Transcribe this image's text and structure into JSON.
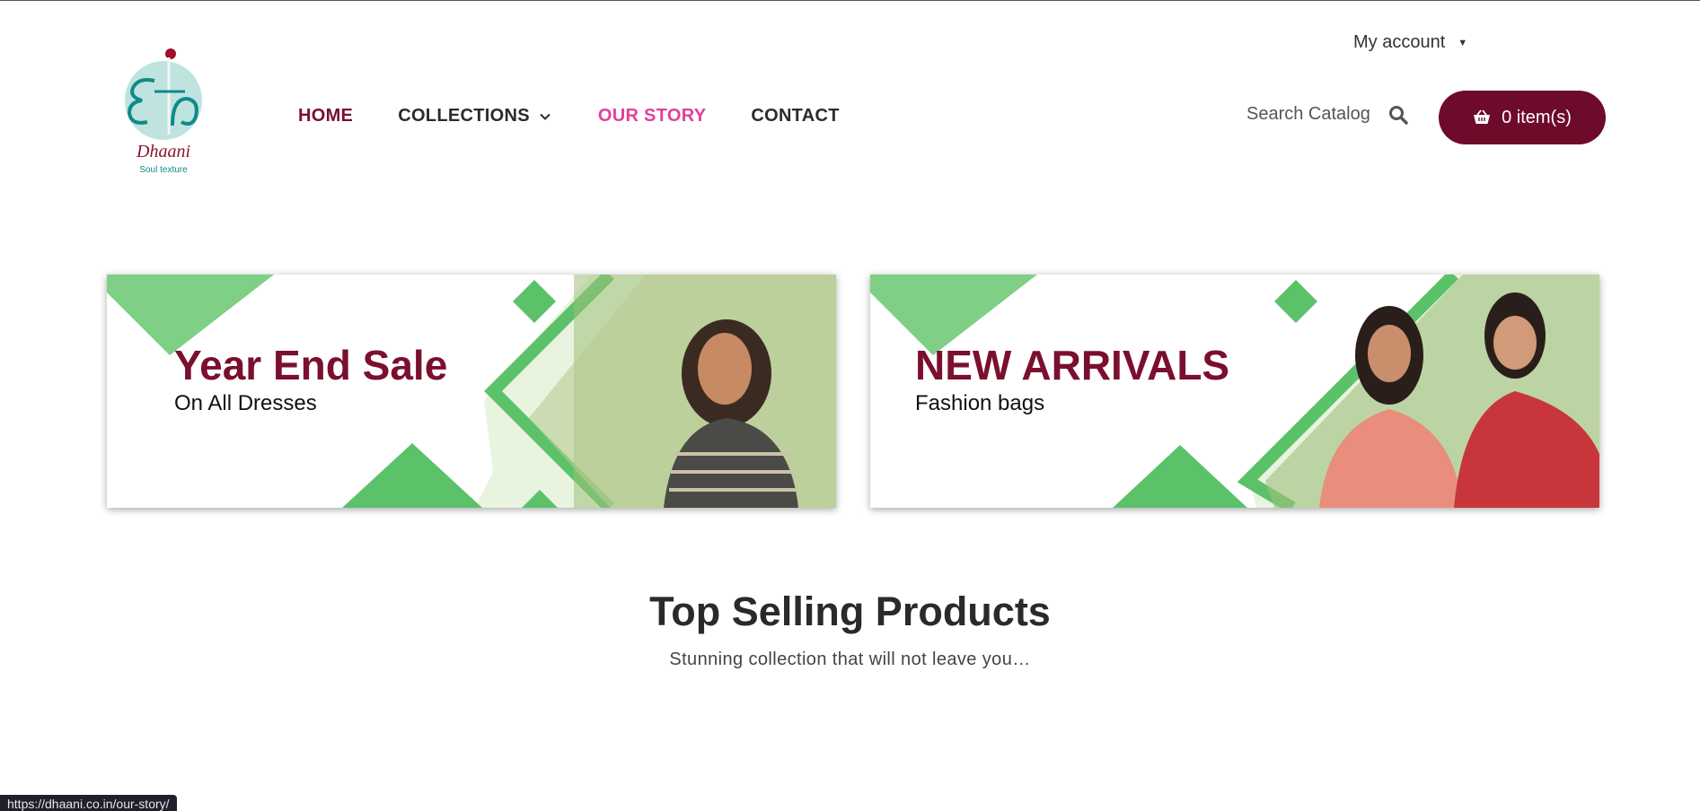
{
  "header": {
    "account_label": "My account",
    "logo_text": "Dhaani",
    "logo_tagline": "Soul texture"
  },
  "nav": {
    "home": "HOME",
    "collections": "COLLECTIONS",
    "our_story": "OUR STORY",
    "contact": "CONTACT"
  },
  "search": {
    "placeholder": "Search Catalog"
  },
  "cart": {
    "label": "0 item(s)"
  },
  "banners": [
    {
      "headline": "Year End Sale",
      "subline": "On All Dresses"
    },
    {
      "headline": "NEW ARRIVALS",
      "subline": "Fashion bags"
    }
  ],
  "section": {
    "title": "Top Selling Products",
    "subtitle": "Stunning collection that will not leave you…"
  },
  "status_bar": {
    "url": "https://dhaani.co.in/our-story/"
  },
  "colors": {
    "brand_maroon": "#6e0a2a",
    "accent_pink": "#e23f9a",
    "banner_green": "#5cc26a",
    "logo_teal": "#0e8a8a"
  },
  "icons": [
    "caret-down-icon",
    "chevron-down-icon",
    "search-icon",
    "basket-icon"
  ]
}
